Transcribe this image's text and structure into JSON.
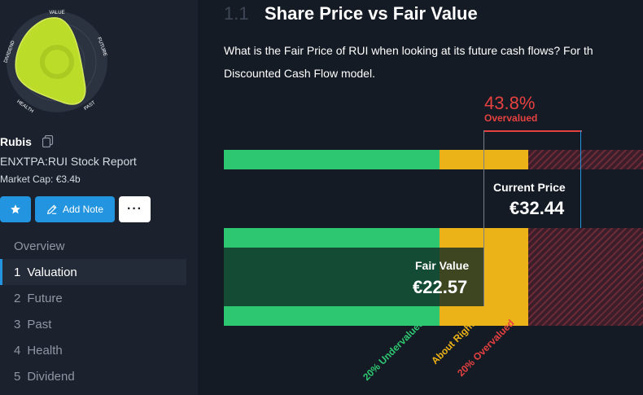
{
  "snowflake": {
    "axis_labels": {
      "value": "VALUE",
      "future": "FUTURE",
      "past": "PAST",
      "health": "HEALTH",
      "dividend": "DIVIDEND"
    },
    "fill_color": "#c4e629"
  },
  "company": {
    "name": "Rubis",
    "ticker": "ENXTPA:RUI Stock Report",
    "market_cap": "Market Cap: €3.4b"
  },
  "actions": {
    "star_icon": "star-icon",
    "add_note_label": "Add Note",
    "more_label": "···"
  },
  "nav": {
    "items": [
      {
        "num": "",
        "label": "Overview",
        "active": false
      },
      {
        "num": "1",
        "label": "Valuation",
        "active": true
      },
      {
        "num": "2",
        "label": "Future",
        "active": false
      },
      {
        "num": "3",
        "label": "Past",
        "active": false
      },
      {
        "num": "4",
        "label": "Health",
        "active": false
      },
      {
        "num": "5",
        "label": "Dividend",
        "active": false
      }
    ]
  },
  "section": {
    "number": "1.1",
    "title": "Share Price vs Fair Value",
    "description_line1": "What is the Fair Price of RUI when looking at its future cash flows? For th",
    "description_line2": "Discounted Cash Flow model."
  },
  "valuation": {
    "overvalued_percent": "43.8%",
    "overvalued_label": "Overvalued",
    "current_price_label": "Current Price",
    "current_price": "€32.44",
    "fair_value_label": "Fair Value",
    "fair_value": "€22.57",
    "zone_labels": {
      "undervalued": "20% Undervalued",
      "about_right": "About Right",
      "overvalued": "20% Overvalued"
    },
    "colors": {
      "undervalued": "#2ec771",
      "about_right": "#ecb318",
      "overvalued": "#e64141",
      "accent": "#2394df"
    }
  }
}
